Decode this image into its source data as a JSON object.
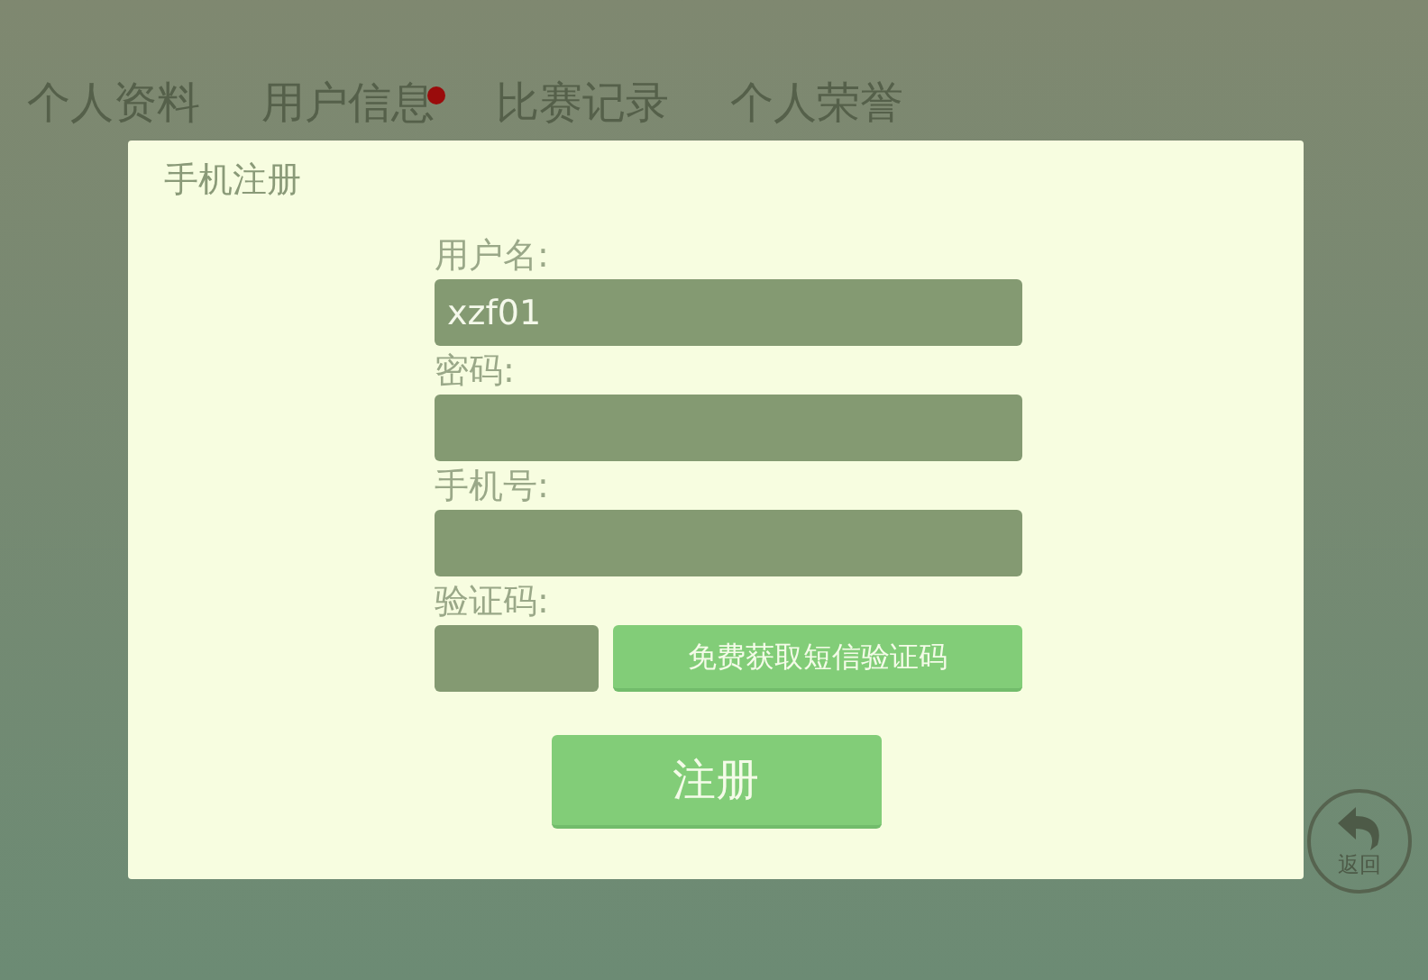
{
  "tabs": [
    {
      "label": "个人资料",
      "badge": false
    },
    {
      "label": "用户信息",
      "badge": true
    },
    {
      "label": "比赛记录",
      "badge": false
    },
    {
      "label": "个人荣誉",
      "badge": false
    }
  ],
  "back_button": {
    "label": "返回"
  },
  "dialog": {
    "title": "手机注册",
    "fields": [
      {
        "label": "用户名:",
        "value": "xzf01",
        "kind": "full"
      },
      {
        "label": "密码:",
        "kind": "full"
      },
      {
        "label": "手机号:",
        "kind": "full"
      },
      {
        "label": "验证码:",
        "kind": "code",
        "button": "免费获取短信验证码"
      }
    ],
    "submit": "注册"
  }
}
